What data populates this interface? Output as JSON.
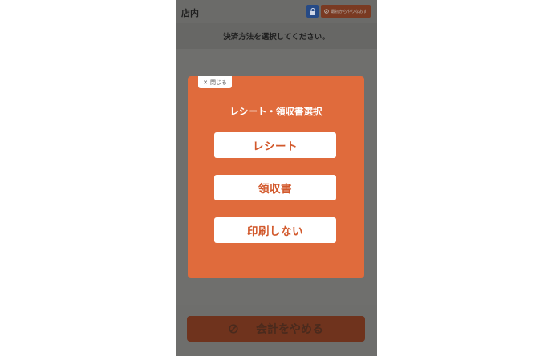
{
  "header": {
    "title": "店内",
    "lock_icon": "lock-icon",
    "redo_label": "最初からやりなおす",
    "redo_icon": "cancel-circle-icon"
  },
  "subbar": {
    "text": "決済方法を選択してください。"
  },
  "modal": {
    "close_label": "閉じる",
    "close_icon": "close-icon",
    "title": "レシート・領収書選択",
    "options": [
      {
        "label": "レシート"
      },
      {
        "label": "領収書"
      },
      {
        "label": "印刷しない"
      }
    ]
  },
  "footer": {
    "cancel_label": "会計をやめる",
    "cancel_icon": "cancel-circle-icon"
  },
  "colors": {
    "accent": "#e06b3c",
    "overlay": "#6e6e6c",
    "lock_button": "#264a86",
    "cancel_button": "#6f331d"
  }
}
